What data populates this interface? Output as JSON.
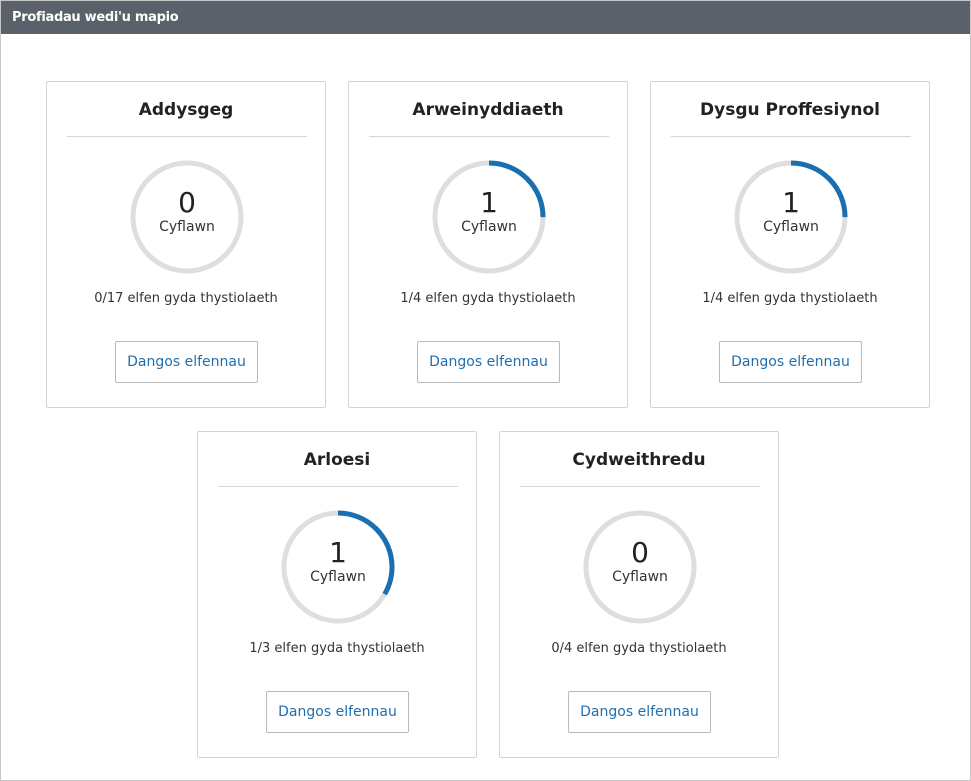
{
  "header": {
    "title": "Profiadau wedi'u mapio"
  },
  "colors": {
    "accent": "#1a6fb0",
    "track": "#dedede",
    "header_bg": "#5b616a"
  },
  "cards": [
    {
      "title": "Addysgeg",
      "complete_count": "0",
      "complete_label": "Cyflawn",
      "evidence": "0/17 elfen gyda thystiolaeth",
      "completed": 0,
      "total": 17,
      "button_label": "Dangos elfennau"
    },
    {
      "title": "Arweinyddiaeth",
      "complete_count": "1",
      "complete_label": "Cyflawn",
      "evidence": "1/4 elfen gyda thystiolaeth",
      "completed": 1,
      "total": 4,
      "button_label": "Dangos elfennau"
    },
    {
      "title": "Dysgu Proffesiynol",
      "complete_count": "1",
      "complete_label": "Cyflawn",
      "evidence": "1/4 elfen gyda thystiolaeth",
      "completed": 1,
      "total": 4,
      "button_label": "Dangos elfennau"
    },
    {
      "title": "Arloesi",
      "complete_count": "1",
      "complete_label": "Cyflawn",
      "evidence": "1/3 elfen gyda thystiolaeth",
      "completed": 1,
      "total": 3,
      "button_label": "Dangos elfennau"
    },
    {
      "title": "Cydweithredu",
      "complete_count": "0",
      "complete_label": "Cyflawn",
      "evidence": "0/4 elfen gyda thystiolaeth",
      "completed": 0,
      "total": 4,
      "button_label": "Dangos elfennau"
    }
  ]
}
